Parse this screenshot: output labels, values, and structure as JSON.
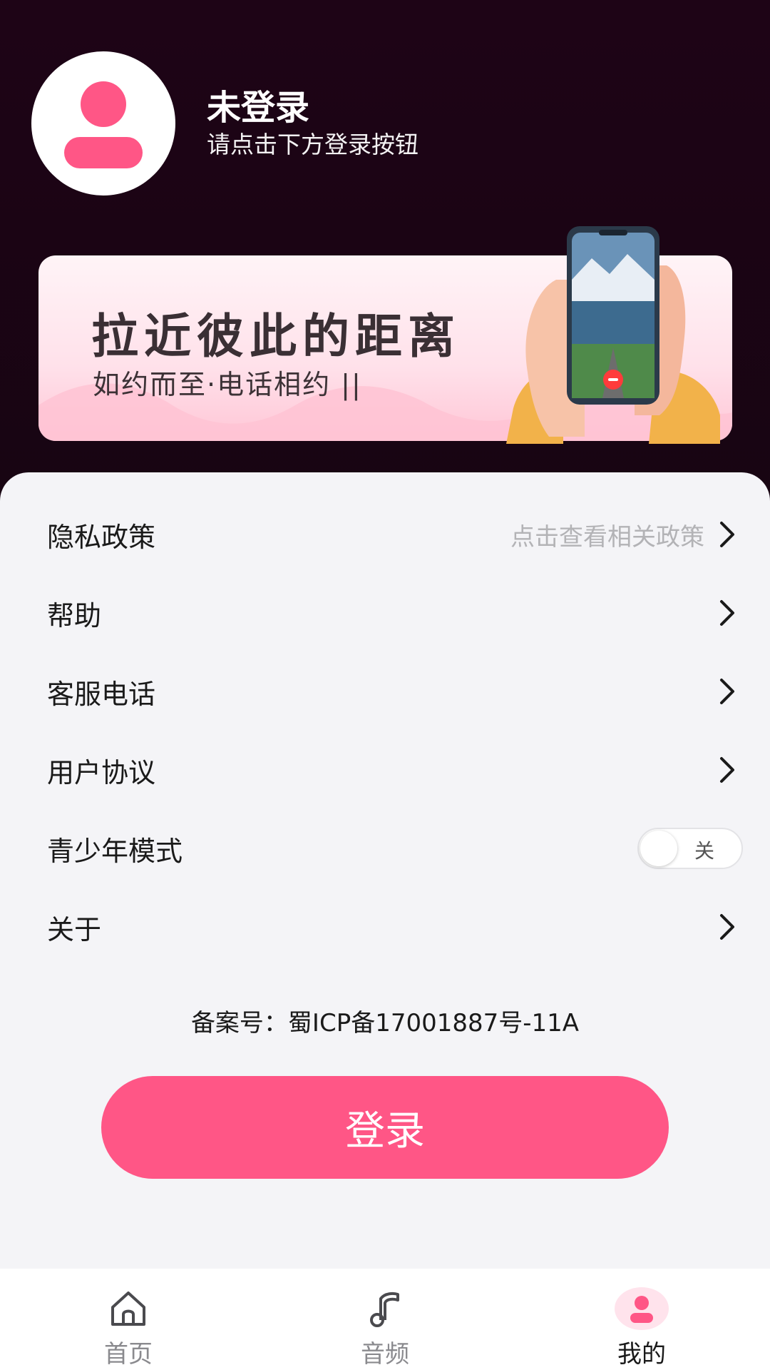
{
  "colors": {
    "accent": "#ff5686",
    "background_dark": "#170512",
    "panel": "#f4f4f7"
  },
  "profile": {
    "name": "未登录",
    "hint": "请点击下方登录按钮"
  },
  "banner": {
    "title": "拉近彼此的距离",
    "subtitle": "如约而至·电话相约 ||"
  },
  "menu": {
    "items": [
      {
        "label": "隐私政策",
        "hint": "点击查看相关政策",
        "icon": "chevron-right-icon"
      },
      {
        "label": "帮助",
        "icon": "chevron-right-icon"
      },
      {
        "label": "客服电话",
        "icon": "chevron-right-icon"
      },
      {
        "label": "用户协议",
        "icon": "chevron-right-icon"
      },
      {
        "label": "青少年模式",
        "toggle_state": "关",
        "toggle_on": false
      },
      {
        "label": "关于",
        "icon": "chevron-right-icon"
      }
    ]
  },
  "icp": "备案号：蜀ICP备17001887号-11A",
  "login_button": "登录",
  "tabbar": {
    "tabs": [
      {
        "label": "首页",
        "icon": "home-icon",
        "active": false
      },
      {
        "label": "音频",
        "icon": "music-note-icon",
        "active": false
      },
      {
        "label": "我的",
        "icon": "profile-icon",
        "active": true
      }
    ]
  }
}
